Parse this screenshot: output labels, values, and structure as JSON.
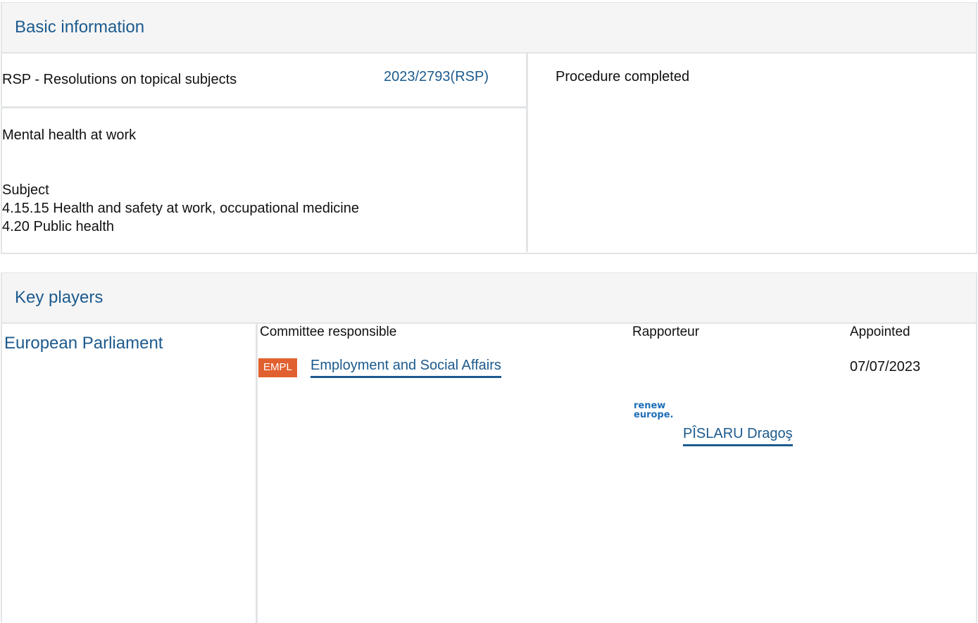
{
  "basic_information": {
    "heading": "Basic information",
    "procedure_type": "RSP - Resolutions on topical subjects",
    "procedure_reference": "2023/2793(RSP)",
    "status": "Procedure completed",
    "title": "Mental health at work",
    "subject_label": "Subject",
    "subjects": [
      "4.15.15 Health and safety at work, occupational medicine",
      "4.20 Public health"
    ]
  },
  "key_players": {
    "heading": "Key players",
    "institution": "European Parliament",
    "columns": {
      "committee": "Committee responsible",
      "rapporteur": "Rapporteur",
      "appointed": "Appointed"
    },
    "committee": {
      "code": "EMPL",
      "name": "Employment and Social Affairs",
      "badge_color": "#e0612f"
    },
    "appointed_date": "07/07/2023",
    "rapporteur": {
      "group_logo_text": [
        "renew",
        "europe."
      ],
      "name": "PÎSLARU Dragoş"
    }
  }
}
